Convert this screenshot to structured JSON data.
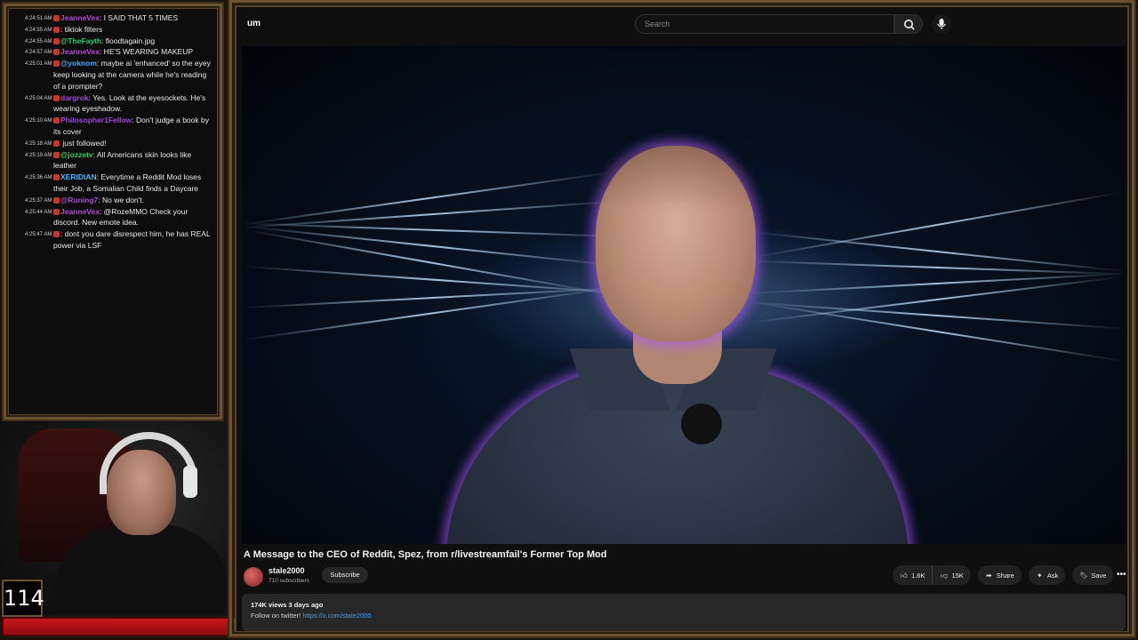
{
  "chat": {
    "messages": [
      {
        "time": "4:24:51 AM",
        "user": "JeanneVex",
        "user_color": "#b34bd6",
        "text": ": I SAID THAT 5 TIMES"
      },
      {
        "time": "4:24:55 AM",
        "user": "",
        "user_color": "#b34bd6",
        "text": ": tiktok filters"
      },
      {
        "time": "4:24:55 AM",
        "user": "@TheFayth",
        "user_color": "#2ecc71",
        "text": ": floodtagain.jpg"
      },
      {
        "time": "4:24:57 AM",
        "user": "JeanneVex",
        "user_color": "#b34bd6",
        "text": ": HE'S WEARING MAKEUP"
      },
      {
        "time": "4:25:01 AM",
        "user": "@yoknom",
        "user_color": "#4aa3ff",
        "text": ": maybe ai 'enhanced' so the eyey keep looking at the camera while he's reading of a prompter?"
      },
      {
        "time": "4:25:04 AM",
        "user": "dargrok",
        "user_color": "#a04ad6",
        "text": ": Yes. Look at the eyesockets. He's wearing eyeshadow."
      },
      {
        "time": "4:25:10 AM",
        "user": "Philosopher1Fellow",
        "user_color": "#9a4ad6",
        "text": ": Don't judge a book by its cover"
      },
      {
        "time": "4:25:18 AM",
        "user": "",
        "user_color": "#3a4fd6",
        "text": " just followed!"
      },
      {
        "time": "4:25:19 AM",
        "user": "@jozzetv",
        "user_color": "#2ecc71",
        "text": ": All Americans skin looks like leather"
      },
      {
        "time": "4:25:36 AM",
        "user": "XERIDIAN",
        "user_color": "#4ab8ff",
        "text": ": Everytime a Reddit Mod loses their Job, a Somalian Child finds a Daycare"
      },
      {
        "time": "4:25:37 AM",
        "user": "@Runing7",
        "user_color": "#a04ad6",
        "text": ": No we don't."
      },
      {
        "time": "4:25:44 AM",
        "user": "JeanneVex",
        "user_color": "#b34bd6",
        "text": ": @RozeMMO Check your discord. New emote idea."
      },
      {
        "time": "4:25:47 AM",
        "user": "",
        "user_color": "#3a4fd6",
        "text": ": dont you dare disrespect him, he has REAL power via LSF"
      }
    ]
  },
  "overlay": {
    "counter": "114"
  },
  "youtube": {
    "logo_fragment": "um",
    "search_placeholder": "Search",
    "video": {
      "title": "A Message to the CEO of Reddit, Spez, from r/livestreamfail's Former Top Mod",
      "channel": "stale2000",
      "subscribers": "710 subscribers",
      "subscribe_label": "Subscribe",
      "likes": "1.6K",
      "dislikes": "15K",
      "share_label": "Share",
      "ask_label": "Ask",
      "save_label": "Save",
      "views_date": "174K views  3 days ago",
      "desc_prefix": "Follow on twitter!",
      "desc_link": "https://x.com/stale2000"
    }
  }
}
